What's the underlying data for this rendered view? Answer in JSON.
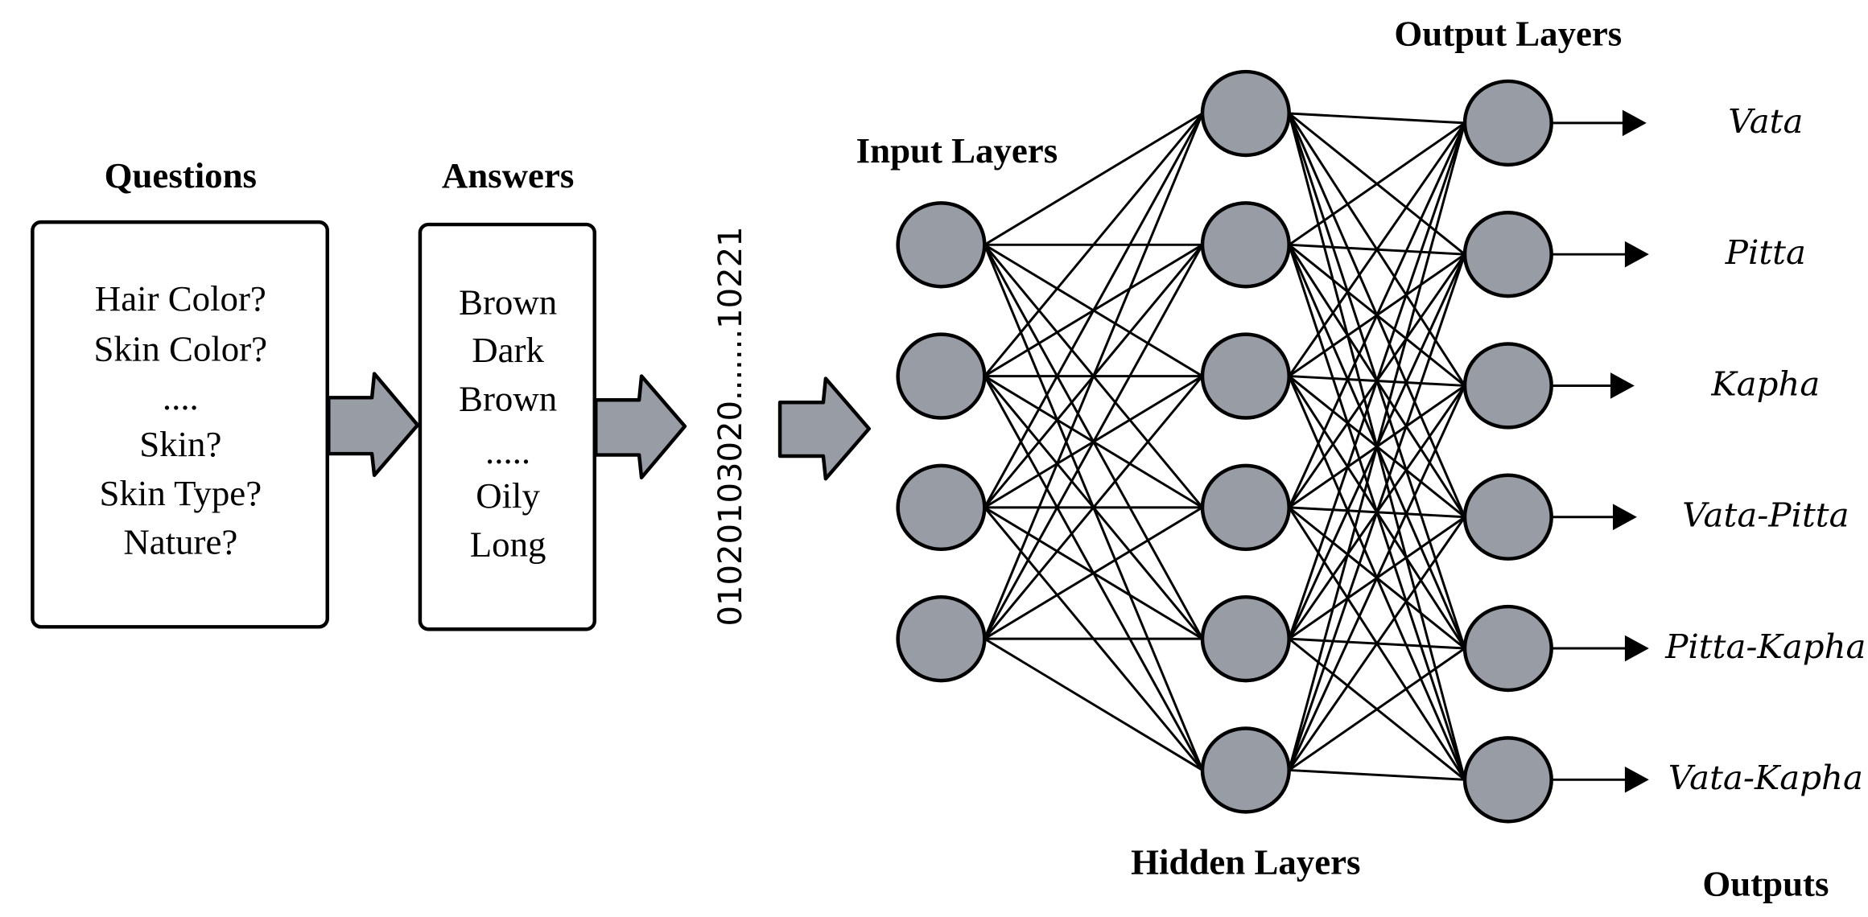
{
  "questions": {
    "title": "Questions",
    "items": [
      "Hair Color?",
      "Skin Color?",
      "....",
      "Skin?",
      "Skin Type?",
      "Nature?"
    ]
  },
  "answers": {
    "title": "Answers",
    "items": [
      "Brown",
      "Dark",
      "Brown",
      ".....",
      "Oily",
      "Long"
    ]
  },
  "encoded_vector": "01020103020.......10221",
  "network": {
    "input_label": "Input Layers",
    "hidden_label": "Hidden Layers",
    "output_label": "Output Layers",
    "input_nodes": 4,
    "hidden_nodes": 6,
    "output_nodes": 6,
    "node_fill": "#979ca5",
    "arrow_fill": "#979ca5"
  },
  "outputs": {
    "title": "Outputs",
    "items": [
      "Vata",
      "Pitta",
      "Kapha",
      "Vata-Pitta",
      "Pitta-Kapha",
      "Vata-Kapha"
    ]
  }
}
